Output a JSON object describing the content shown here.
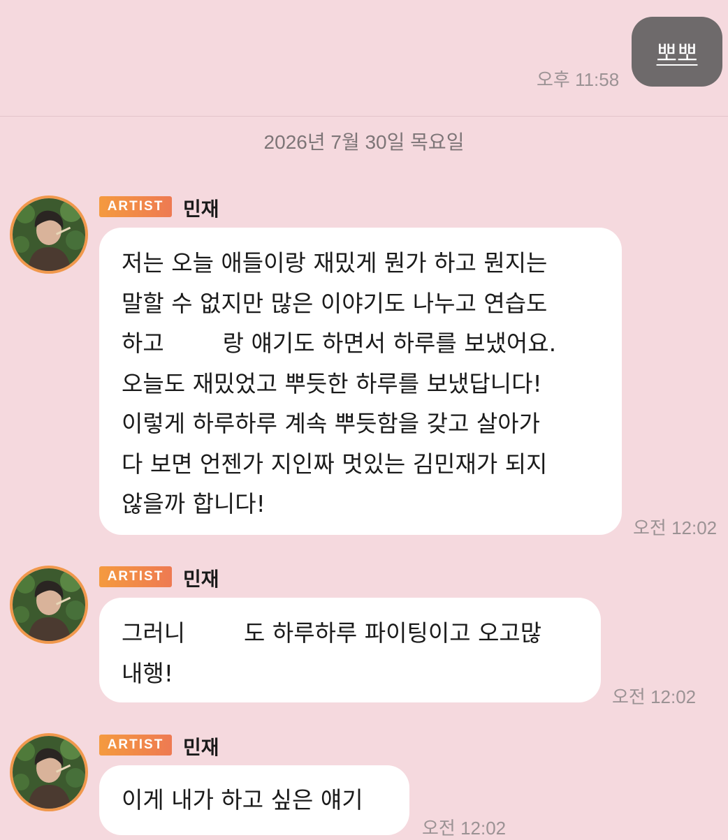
{
  "top": {
    "sent_message": "뽀뽀",
    "sent_time": "오후 11:58"
  },
  "date_separator": "2026년 7월 30일 목요일",
  "colors": {
    "background": "#f5d9de",
    "sent_bubble": "#6e6a6b",
    "received_bubble": "#ffffff",
    "badge_start": "#f49a3f",
    "badge_end": "#ee7a52",
    "avatar_ring": "#f0984c"
  },
  "messages": [
    {
      "badge": "ARTIST",
      "sender": "민재",
      "text": "저는 오늘 애들이랑 재밌게 뭔가 하고 뭔지는\n말할 수 없지만 많은 이야기도 나누고 연습도\n하고        랑 얘기도 하면서 하루를 보냈어요.\n오늘도 재밌었고 뿌듯한 하루를 보냈답니다!\n이렇게 하루하루 계속 뿌듯함을 갖고 살아가\n다 보면 언젠가 지인짜 멋있는 김민재가 되지\n않을까 합니다!",
      "time": "오전 12:02"
    },
    {
      "badge": "ARTIST",
      "sender": "민재",
      "text": "그러니        도 하루하루 파이팅이고 오고많\n내행!",
      "time": "오전 12:02"
    },
    {
      "badge": "ARTIST",
      "sender": "민재",
      "text": "이게 내가 하고 싶은 얘기",
      "time": "오전 12:02"
    }
  ]
}
